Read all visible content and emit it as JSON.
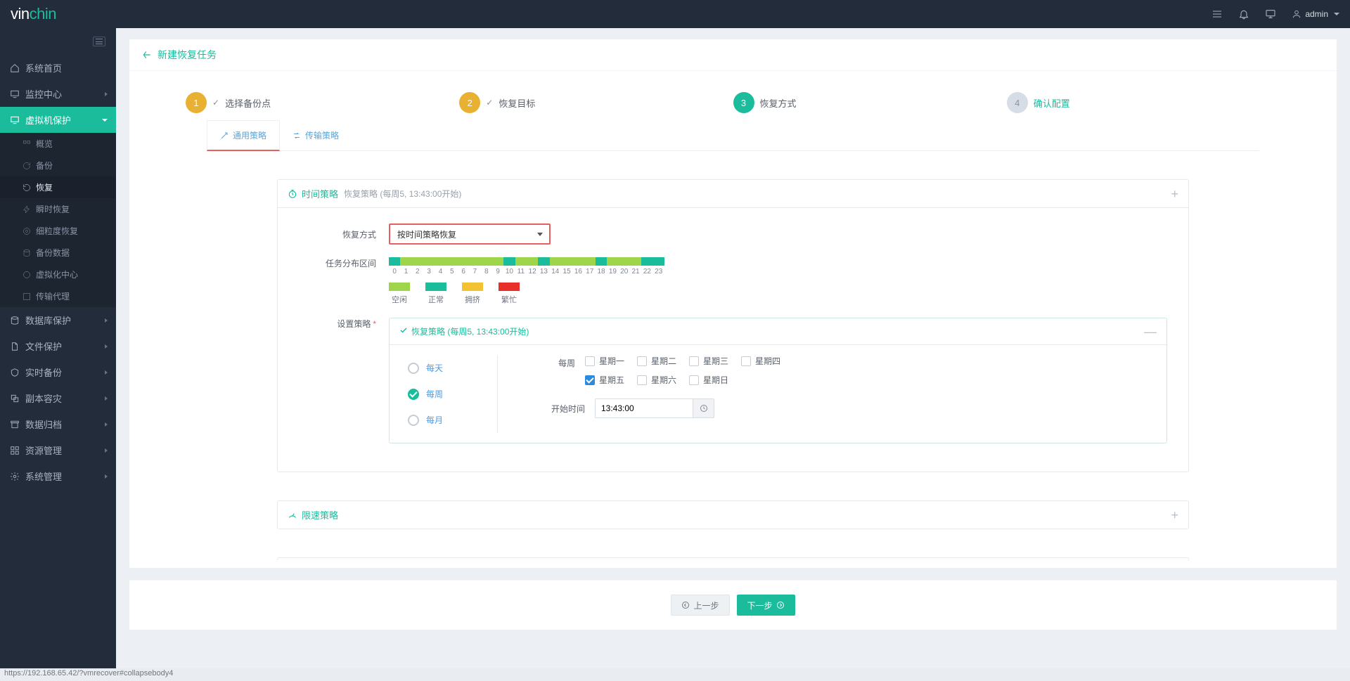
{
  "brand": {
    "v": "vin",
    "c": "chin"
  },
  "user": {
    "name": "admin"
  },
  "sidebar": {
    "items": [
      {
        "label": "系统首页"
      },
      {
        "label": "监控中心"
      },
      {
        "label": "虚拟机保护"
      },
      {
        "label": "数据库保护"
      },
      {
        "label": "文件保护"
      },
      {
        "label": "实时备份"
      },
      {
        "label": "副本容灾"
      },
      {
        "label": "数据归档"
      },
      {
        "label": "资源管理"
      },
      {
        "label": "系统管理"
      }
    ],
    "vmSub": [
      {
        "label": "概览"
      },
      {
        "label": "备份"
      },
      {
        "label": "恢复"
      },
      {
        "label": "瞬时恢复"
      },
      {
        "label": "细粒度恢复"
      },
      {
        "label": "备份数据"
      },
      {
        "label": "虚拟化中心"
      },
      {
        "label": "传输代理"
      }
    ]
  },
  "pageTitle": "新建恢复任务",
  "steps": [
    {
      "num": "1",
      "label": "选择备份点"
    },
    {
      "num": "2",
      "label": "恢复目标"
    },
    {
      "num": "3",
      "label": "恢复方式"
    },
    {
      "num": "4",
      "label": "确认配置"
    }
  ],
  "tabs": [
    {
      "label": "通用策略"
    },
    {
      "label": "传输策略"
    }
  ],
  "timePolicy": {
    "title": "时间策略",
    "subtitle": "恢复策略 (每周5, 13:43:00开始)",
    "restoreModeLabel": "恢复方式",
    "restoreModeValue": "按时间策略恢复",
    "distributionLabel": "任务分布区间",
    "legend": {
      "idle": "空闲",
      "normal": "正常",
      "busy1": "拥挤",
      "busy2": "繁忙"
    },
    "setPolicyLabel": "设置策略",
    "policyTitle": "恢复策略 (每周5, 13:43:00开始)",
    "freq": {
      "daily": "每天",
      "weekly": "每周",
      "monthly": "每月"
    },
    "weekLabel": "每周",
    "days": {
      "mon": "星期一",
      "tue": "星期二",
      "wed": "星期三",
      "thu": "星期四",
      "fri": "星期五",
      "sat": "星期六",
      "sun": "星期日"
    },
    "startTimeLabel": "开始时间",
    "startTimeValue": "13:43:00"
  },
  "speedPolicy": {
    "title": "限速策略"
  },
  "nav": {
    "prev": "上一步",
    "next": "下一步"
  },
  "statusUrl": "https://192.168.65.42/?vmrecover#collapsebody4",
  "hourTicks": [
    "0",
    "1",
    "2",
    "3",
    "4",
    "5",
    "6",
    "7",
    "8",
    "9",
    "10",
    "11",
    "12",
    "13",
    "14",
    "15",
    "16",
    "17",
    "18",
    "19",
    "20",
    "21",
    "22",
    "23"
  ],
  "hourColors": [
    "teal",
    "",
    "",
    "",
    "",
    "",
    "",
    "",
    "",
    "",
    "teal",
    "",
    "",
    "teal",
    "",
    "",
    "",
    "",
    "teal",
    "",
    "",
    "",
    "teal",
    "teal"
  ]
}
